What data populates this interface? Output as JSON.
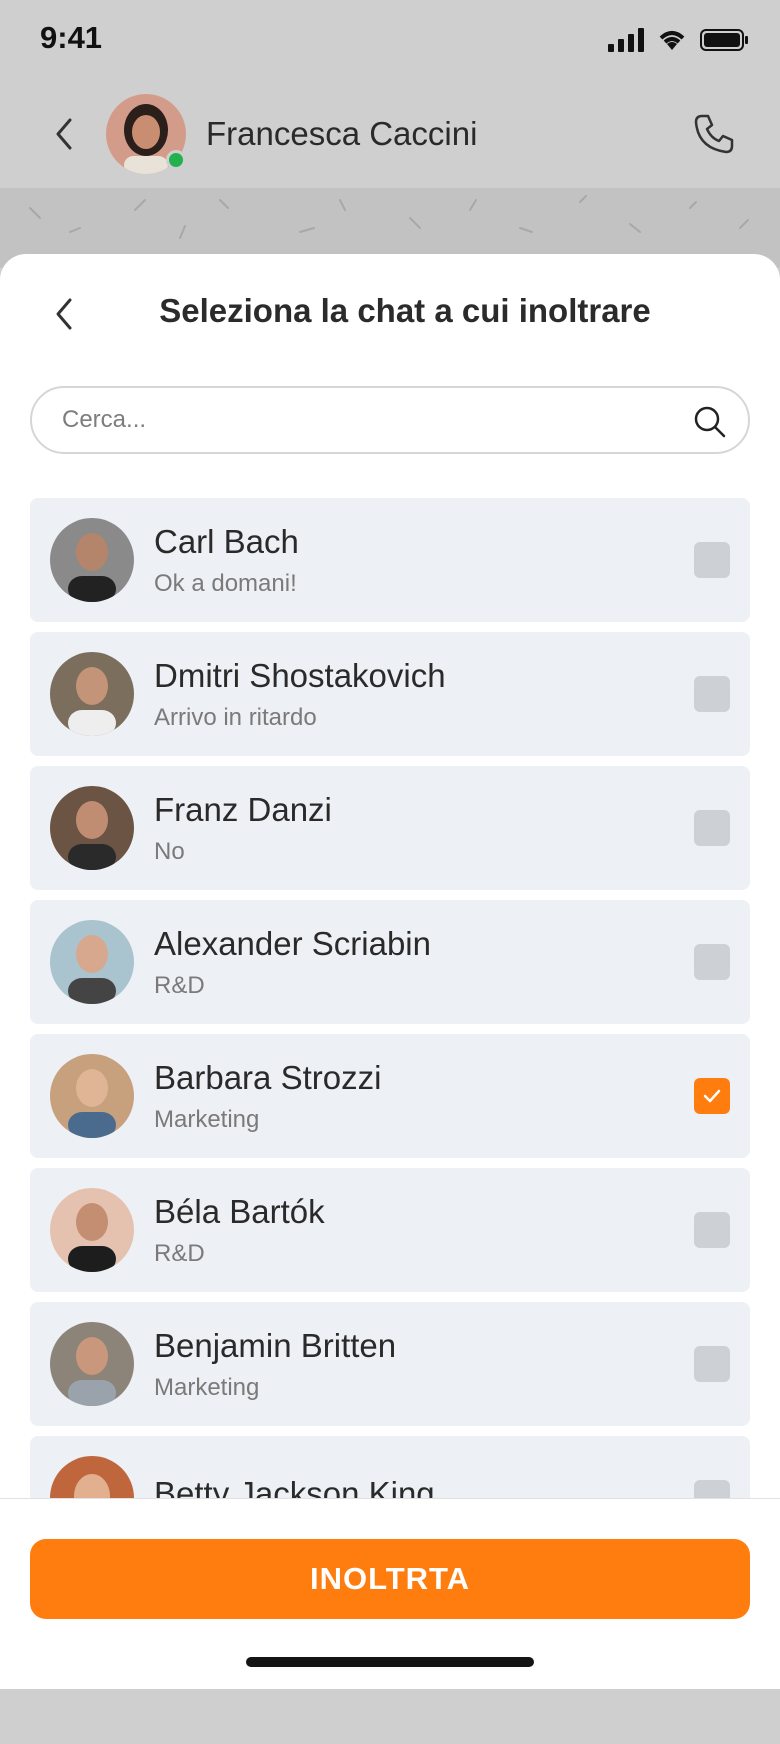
{
  "status_bar": {
    "time": "9:41"
  },
  "chat_header": {
    "contact_name": "Francesca Caccini",
    "online": true
  },
  "sheet": {
    "title": "Seleziona la chat a cui inoltrare",
    "search_placeholder": "Cerca..."
  },
  "contacts": [
    {
      "name": "Carl Bach",
      "subtitle": "Ok a domani!",
      "selected": false,
      "avatar_color": "#8a8a8a"
    },
    {
      "name": "Dmitri Shostakovich",
      "subtitle": "Arrivo in ritardo",
      "selected": false,
      "avatar_color": "#7b6e5d"
    },
    {
      "name": "Franz Danzi",
      "subtitle": "No",
      "selected": false,
      "avatar_color": "#6b5444"
    },
    {
      "name": "Alexander Scriabin",
      "subtitle": "R&D",
      "selected": false,
      "avatar_color": "#a9c3cf"
    },
    {
      "name": "Barbara Strozzi",
      "subtitle": "Marketing",
      "selected": true,
      "avatar_color": "#c7a07e"
    },
    {
      "name": "Béla Bartók",
      "subtitle": "R&D",
      "selected": false,
      "avatar_color": "#3a3330"
    },
    {
      "name": "Benjamin Britten",
      "subtitle": "Marketing",
      "selected": false,
      "avatar_color": "#8c8478"
    },
    {
      "name": "Betty Jackson King",
      "subtitle": "",
      "selected": false,
      "avatar_color": "#c0663d"
    }
  ],
  "footer": {
    "button_label": "INOLTRTA"
  },
  "colors": {
    "accent": "#ff7d0e",
    "list_bg": "#edf0f4",
    "online": "#22b14c"
  }
}
